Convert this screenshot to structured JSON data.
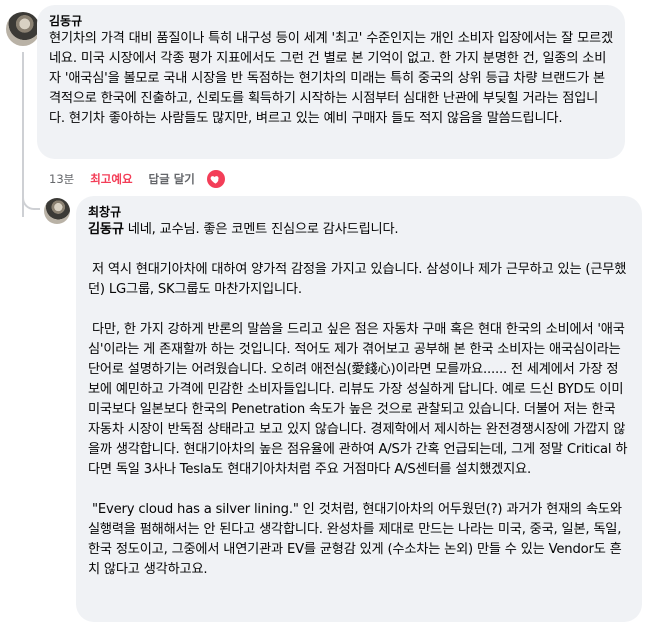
{
  "comment": {
    "author": "김동규",
    "text": "현기차의 가격 대비 품질이나 특히 내구성 등이 세계 '최고' 수준인지는 개인 소비자 입장에서는 잘 모르겠네요. 미국 시장에서 각종 평가 지표에서도 그런 건 별로 본 기억이 없고. 한 가지 분명한 건, 일종의 소비자 '애국심'을 볼모로 국내 시장을 반 독점하는 현기차의 미래는 특히 중국의 상위 등급 차량 브랜드가 본격적으로 한국에 진출하고, 신뢰도를 획득하기 시작하는 시점부터 심대한 난관에 부딪힐 거라는 점입니다. 현기차 좋아하는 사람들도 많지만, 벼르고 있는 예비 구매자 들도 적지 않음을 말씀드립니다.",
    "time": "13분",
    "liked_label": "최고예요",
    "reply_label": "답글 달기",
    "reaction_icon": "heart-icon",
    "reaction_color": "#f33e58"
  },
  "reply": {
    "author": "최창규",
    "mention": "김동규",
    "text": " 네네, 교수님. 좋은 코멘트 진심으로 감사드립니다.\n\n 저 역시 현대기아차에 대하여 양가적 감정을 가지고 있습니다. 삼성이나 제가 근무하고 있는 (근무했던) LG그룹, SK그룹도 마찬가지입니다.\n\n 다만, 한 가지 강하게 반론의 말씀을 드리고 싶은 점은 자동차 구매 혹은 현대 한국의 소비에서 '애국심'이라는 게 존재할까 하는 것입니다. 적어도 제가 겪어보고 공부해 본 한국 소비자는 애국심이라는 단어로 설명하기는 어려웠습니다. 오히려 애전심(愛錢心)이라면 모를까요...... 전 세계에서 가장 정보에 예민하고 가격에 민감한 소비자들입니다. 리뷰도 가장 성실하게 답니다. 예로 드신 BYD도 이미 미국보다 일본보다 한국의 Penetration 속도가 높은 것으로 관찰되고 있습니다. 더불어 저는 한국 자동차 시장이 반독점 상태라고 보고 있지 않습니다. 경제학에서 제시하는 완전경쟁시장에 가깝지 않을까 생각합니다. 현대기아차의 높은 점유율에 관하여 A/S가 간혹 언급되는데, 그게 정말 Critical 하다면 독일 3사나 Tesla도 현대기아차처럼 주요 거점마다 A/S센터를 설치했겠지요.\n\n \"Every cloud has a silver lining.\" 인 것처럼, 현대기아차의 어두웠던(?) 과거가 현재의 속도와 실행력을 펌해해서는 안 된다고 생각합니다. 완성차를 제대로 만드는 나라는 미국, 중국, 일본, 독일, 한국 정도이고, 그중에서 내연기관과 EV를 균형감 있게 (수소차는 논외) 만들 수 있는 Vendor도 흔치 않다고 생각하고요."
  }
}
